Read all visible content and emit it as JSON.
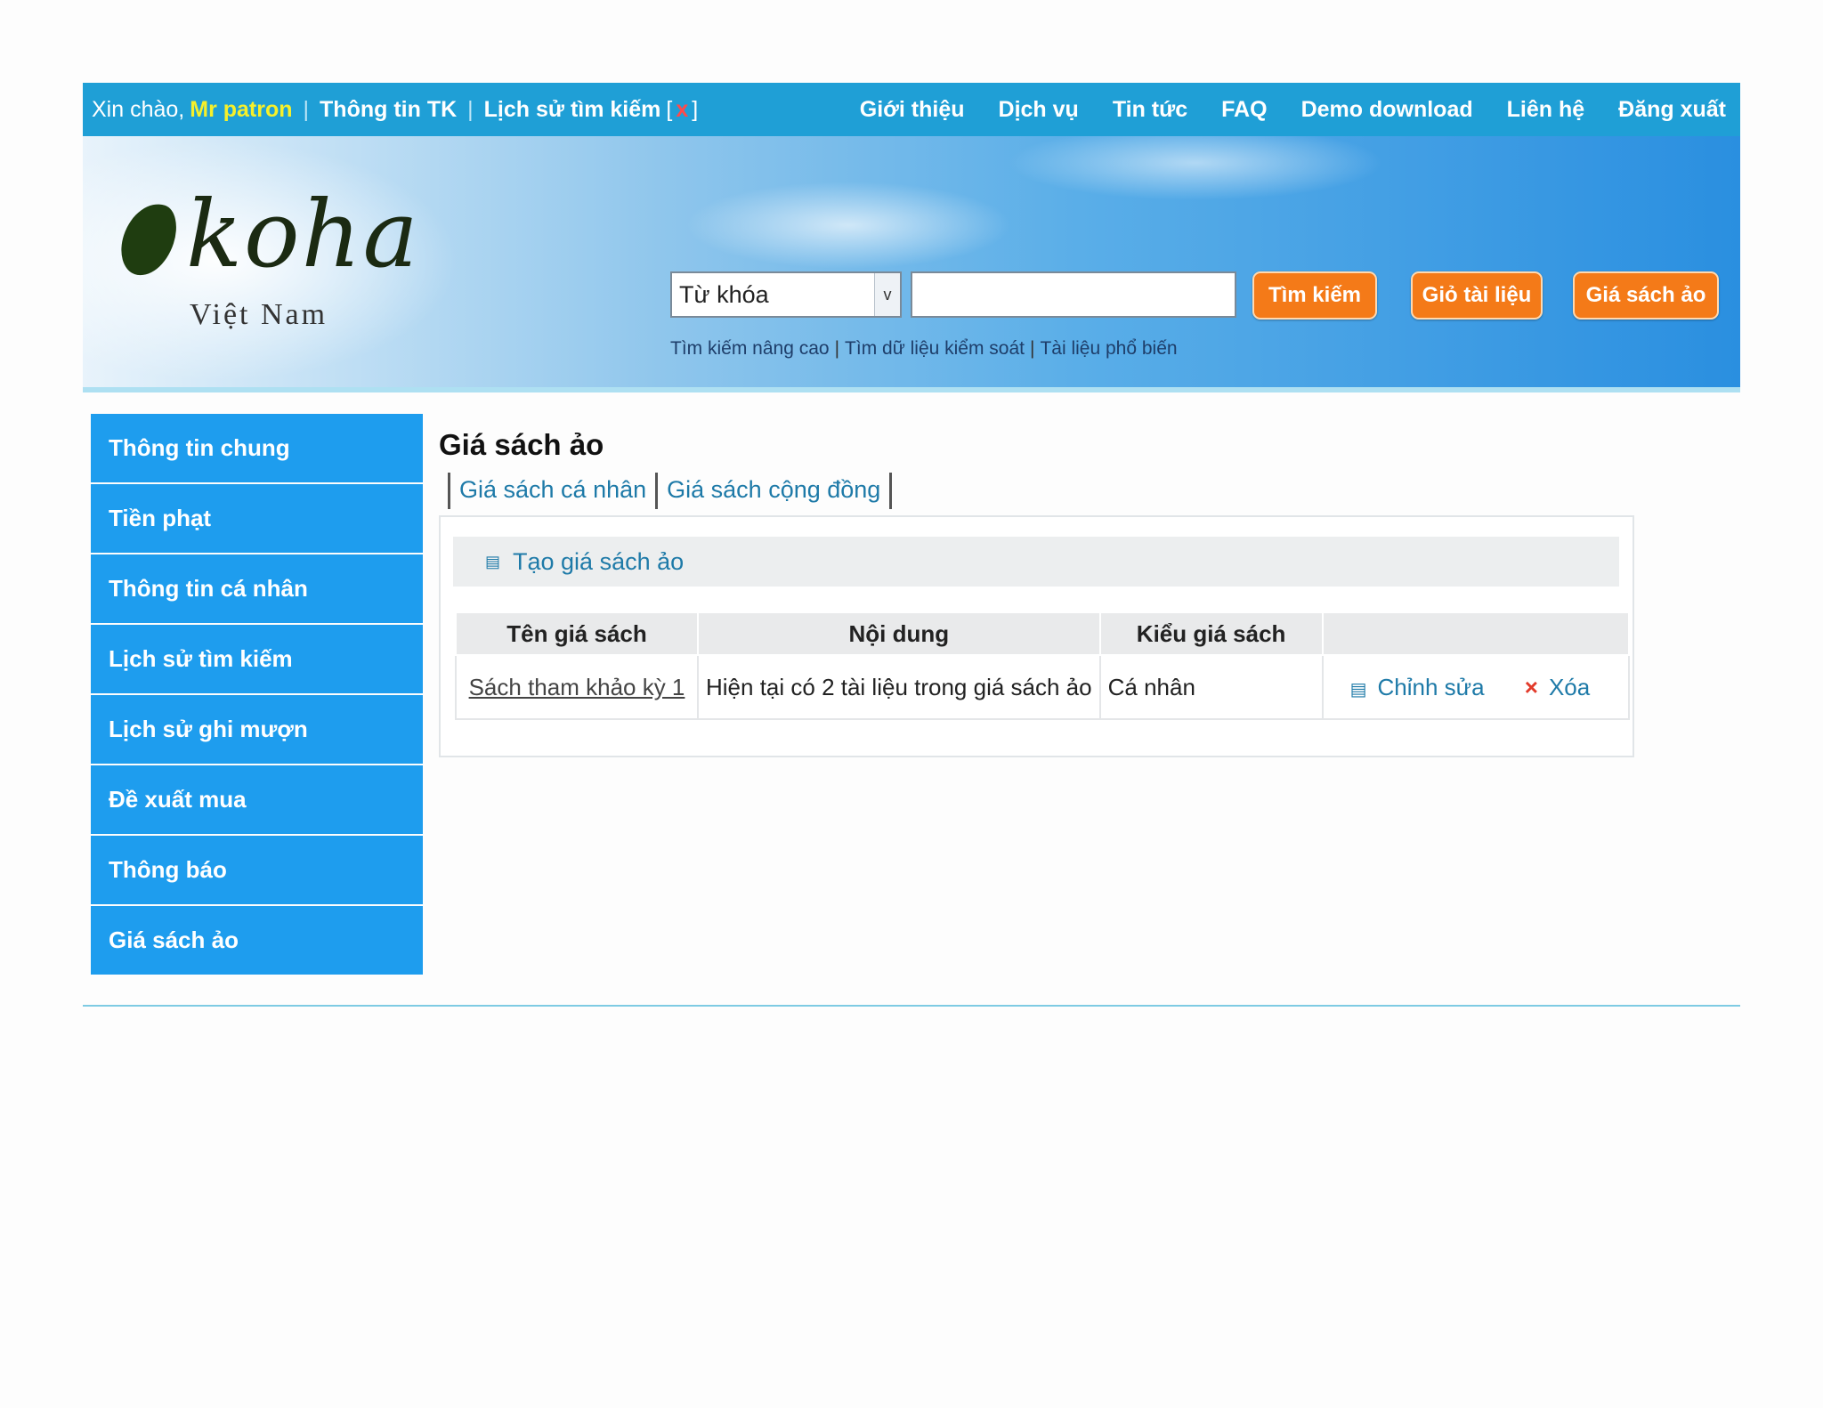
{
  "topbar": {
    "greeting": "Xin chào,",
    "user": "Mr patron",
    "account_info": "Thông tin TK",
    "search_history": "Lịch sử tìm kiếm",
    "bracket_open": "[",
    "clear": "x",
    "bracket_close": "]",
    "nav": [
      "Giới thiệu",
      "Dịch vụ",
      "Tin tức",
      "FAQ",
      "Demo download",
      "Liên hệ",
      "Đăng xuất"
    ]
  },
  "logo": {
    "word": "koha",
    "sub": "Việt Nam"
  },
  "search": {
    "select_value": "Từ khóa",
    "select_arrow": "v",
    "search_button": "Tìm kiếm",
    "cart_button": "Giỏ tài liệu",
    "shelf_button": "Giá sách ảo",
    "sublinks": [
      "Tìm kiếm nâng cao",
      "Tìm dữ liệu kiểm soát",
      "Tài liệu phổ biến"
    ]
  },
  "sidebar": {
    "items": [
      "Thông tin chung",
      "Tiền phạt",
      "Thông tin cá nhân",
      "Lịch sử tìm kiếm",
      "Lịch sử ghi mượn",
      "Đề xuất mua",
      "Thông báo",
      "Giá sách ảo"
    ]
  },
  "main": {
    "title": "Giá sách ảo",
    "tabs": [
      "Giá sách cá nhân",
      "Giá sách cộng đồng"
    ],
    "create_label": "Tạo giá sách ảo",
    "table": {
      "headers": [
        "Tên giá sách",
        "Nội dung",
        "Kiểu giá sách",
        ""
      ],
      "rows": [
        {
          "name": "Sách tham khảo kỳ 1",
          "content": "Hiện tại có 2 tài liệu trong giá sách ảo",
          "type": "Cá nhân",
          "edit": "Chỉnh sửa",
          "delete": "Xóa"
        }
      ]
    }
  },
  "colors": {
    "topbar": "#1f9fd6",
    "sidebar": "#1e9dee",
    "button": "#f47a18",
    "username": "#f6f02a",
    "link": "#1e7aa8"
  }
}
